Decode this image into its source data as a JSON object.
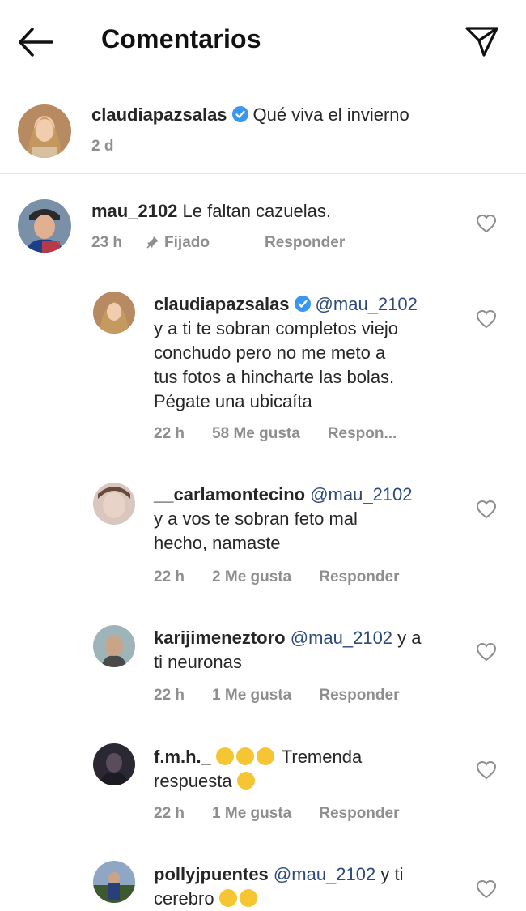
{
  "header": {
    "title": "Comentarios",
    "back_icon": "back-arrow-icon",
    "send_icon": "send-icon"
  },
  "caption": {
    "username": "claudiapazsalas",
    "verified": true,
    "text": "Qué viva el invierno",
    "time": "2 d"
  },
  "comments": [
    {
      "username": "mau_2102",
      "text": "Le faltan cazuelas.",
      "time": "23 h",
      "pinned_label": "Fijado",
      "reply_label": "Responder"
    }
  ],
  "replies": [
    {
      "username": "claudiapazsalas",
      "verified": true,
      "mention": "@mau_2102",
      "text_line1": "y a ti te sobran completos viejo",
      "text_line2": "conchudo pero no me meto a",
      "text_line3": "tus fotos a hincharte las bolas.",
      "text_line4": "Pégate una ubicaíta",
      "time": "22 h",
      "likes": "58 Me gusta",
      "reply_label": "Respon..."
    },
    {
      "username": "__carlamontecino",
      "mention": "@mau_2102",
      "text_line1": "y a vos te sobran feto mal",
      "text_line2": "hecho, namaste",
      "time": "22 h",
      "likes": "2 Me gusta",
      "reply_label": "Responder"
    },
    {
      "username": "karijimeneztoro",
      "mention": "@mau_2102",
      "text_tail": "y a",
      "text_line2": "ti neuronas",
      "time": "22 h",
      "likes": "1 Me gusta",
      "reply_label": "Responder"
    },
    {
      "username": "f.m.h._",
      "text_tail": "Tremenda",
      "text_line2": "respuesta",
      "time": "22 h",
      "likes": "1 Me gusta",
      "reply_label": "Responder"
    },
    {
      "username": "pollyjpuentes",
      "mention": "@mau_2102",
      "text_tail": "y ti",
      "text_line2": "cerebro"
    }
  ],
  "colors": {
    "text": "#262626",
    "meta": "#8e8e8e",
    "mention": "#2d4a7a",
    "verified": "#3897f0"
  }
}
